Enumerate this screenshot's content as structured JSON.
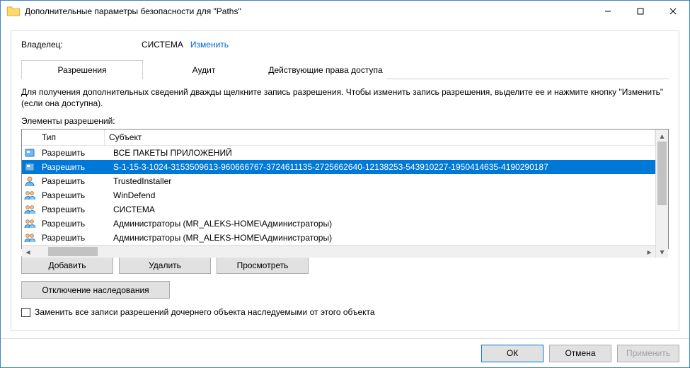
{
  "window": {
    "title": "Дополнительные параметры безопасности  для \"Paths\""
  },
  "owner": {
    "label": "Владелец:",
    "value": "СИСТЕМА",
    "change": "Изменить"
  },
  "tabs": {
    "perm": "Разрешения",
    "audit": "Аудит",
    "effective": "Действующие права доступа"
  },
  "description": "Для получения дополнительных сведений дважды щелкните запись разрешения. Чтобы изменить запись разрешения, выделите ее и нажмите кнопку \"Изменить\" (если она доступна).",
  "listLabel": "Элементы разрешений:",
  "columns": {
    "type": "Тип",
    "subject": "Субъект"
  },
  "rows": [
    {
      "type": "Разрешить",
      "subject": "ВСЕ ПАКЕТЫ ПРИЛОЖЕНИЙ",
      "icon": "pkg",
      "selected": false
    },
    {
      "type": "Разрешить",
      "subject": "S-1-15-3-1024-3153509613-960666767-3724611135-2725662640-12138253-543910227-1950414635-4190290187",
      "icon": "pkg",
      "selected": true
    },
    {
      "type": "Разрешить",
      "subject": "TrustedInstaller",
      "icon": "user",
      "selected": false
    },
    {
      "type": "Разрешить",
      "subject": "WinDefend",
      "icon": "group",
      "selected": false
    },
    {
      "type": "Разрешить",
      "subject": "СИСТЕМА",
      "icon": "group",
      "selected": false
    },
    {
      "type": "Разрешить",
      "subject": "Администраторы (MR_ALEKS-HOME\\Администраторы)",
      "icon": "group",
      "selected": false
    },
    {
      "type": "Разрешить",
      "subject": "Администраторы (MR_ALEKS-HOME\\Администраторы)",
      "icon": "group",
      "selected": false
    }
  ],
  "buttons": {
    "add": "Добавить",
    "remove": "Удалить",
    "view": "Просмотреть",
    "disableInherit": "Отключение наследования",
    "replace": "Заменить все записи разрешений дочернего объекта наследуемыми от этого объекта",
    "ok": "ОК",
    "cancel": "Отмена",
    "apply": "Применить"
  }
}
